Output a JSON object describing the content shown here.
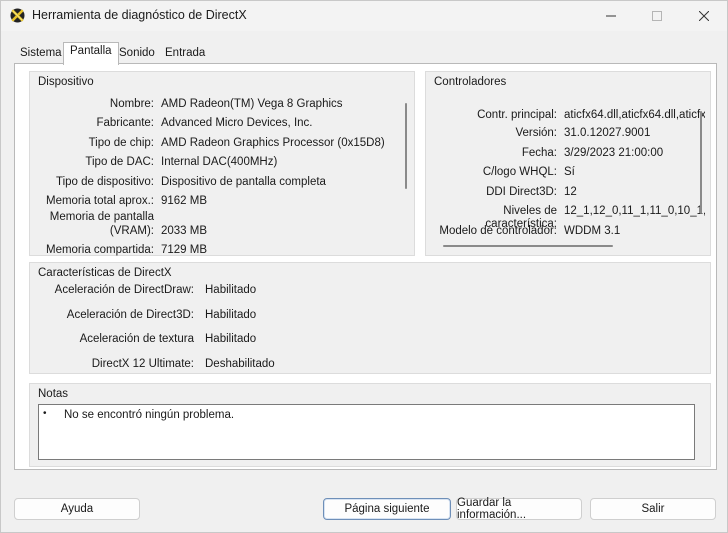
{
  "window": {
    "title": "Herramienta de diagnóstico de DirectX",
    "icon": "directx-icon"
  },
  "tabs": [
    {
      "label": "Sistema",
      "active": false
    },
    {
      "label": "Pantalla",
      "active": true
    },
    {
      "label": "Sonido",
      "active": false
    },
    {
      "label": "Entrada",
      "active": false
    }
  ],
  "device": {
    "title": "Dispositivo",
    "rows": [
      {
        "label": "Nombre:",
        "value": "AMD Radeon(TM) Vega 8 Graphics"
      },
      {
        "label": "Fabricante:",
        "value": "Advanced Micro Devices, Inc."
      },
      {
        "label": "Tipo de chip:",
        "value": "AMD Radeon Graphics Processor (0x15D8)"
      },
      {
        "label": "Tipo de DAC:",
        "value": "Internal DAC(400MHz)"
      },
      {
        "label": "Tipo de dispositivo:",
        "value": "Dispositivo de pantalla completa"
      },
      {
        "label": "Memoria total aprox.:",
        "value": "9162 MB"
      },
      {
        "label": "Memoria de pantalla",
        "label2": "(VRAM):",
        "value": "2033 MB"
      },
      {
        "label": "Memoria compartida:",
        "value": "7129 MB"
      }
    ]
  },
  "drivers": {
    "title": "Controladores",
    "rows": [
      {
        "label": "Contr. principal:",
        "value": "aticfx64.dll,aticfx64.dll,aticfx"
      },
      {
        "label": "Versión:",
        "value": "31.0.12027.9001"
      },
      {
        "label": "Fecha:",
        "value": "3/29/2023 21:00:00"
      },
      {
        "label": "C/logo WHQL:",
        "value": "Sí"
      },
      {
        "label": "DDI Direct3D:",
        "value": "12"
      },
      {
        "label": "Niveles de característica:",
        "value": "12_1,12_0,11_1,11_0,10_1,"
      },
      {
        "label": "Modelo de controlador:",
        "value": "WDDM 3.1"
      }
    ]
  },
  "features": {
    "title": "Características de DirectX",
    "rows": [
      {
        "label": "Aceleración de DirectDraw:",
        "value": "Habilitado"
      },
      {
        "label": "Aceleración de Direct3D:",
        "value": "Habilitado"
      },
      {
        "label": "Aceleración de textura",
        "value": "Habilitado"
      },
      {
        "label": "DirectX 12 Ultimate:",
        "value": "Deshabilitado"
      }
    ]
  },
  "notes": {
    "title": "Notas",
    "bullet": "•",
    "text": "No se encontró ningún problema."
  },
  "buttons": {
    "help": "Ayuda",
    "next_page": "Página siguiente",
    "save_info": "Guardar la información...",
    "exit": "Salir"
  }
}
